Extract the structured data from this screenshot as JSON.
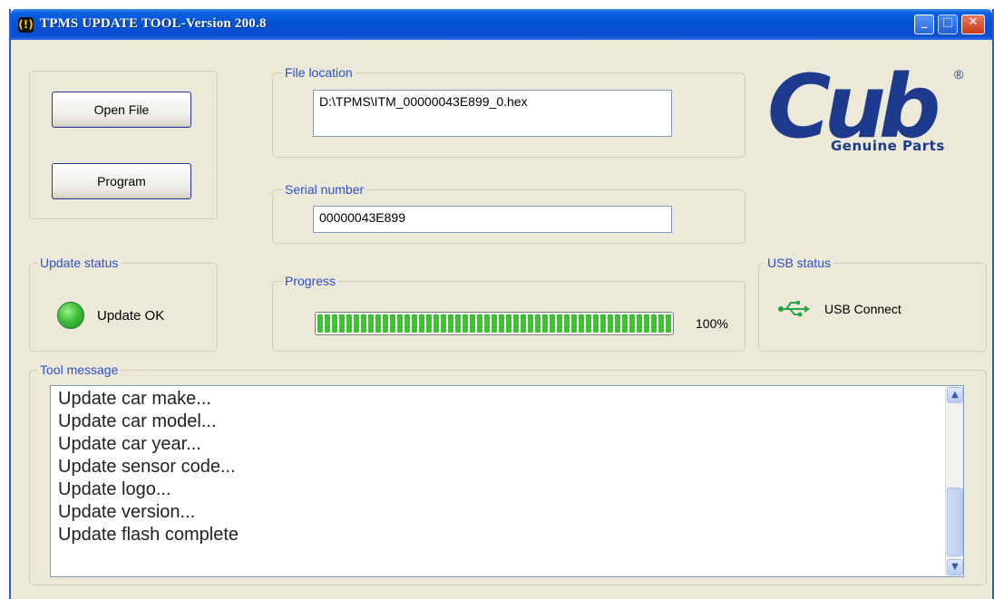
{
  "window": {
    "title": "TPMS UPDATE TOOL-Version 200.8",
    "controls": {
      "minimize": "_",
      "maximize": "□",
      "close": "✕"
    }
  },
  "actions": {
    "open_file_label": "Open File",
    "program_label": "Program"
  },
  "file_location": {
    "legend": "File location",
    "value": "D:\\TPMS\\ITM_00000043E899_0.hex"
  },
  "serial_number": {
    "legend": "Serial number",
    "value": "00000043E899"
  },
  "logo": {
    "brand": "Cub",
    "registered": "®",
    "tagline": "Genuine Parts"
  },
  "update_status": {
    "legend": "Update status",
    "text": "Update OK",
    "indicator_color": "#3fbf3a"
  },
  "progress": {
    "legend": "Progress",
    "value_percent": 100,
    "label": "100%",
    "fill_color": "#3ec234"
  },
  "usb_status": {
    "legend": "USB status",
    "icon": "usb-icon",
    "text": "USB Connect"
  },
  "tool_message": {
    "legend": "Tool message",
    "lines": [
      "Update car make...",
      "Update car model...",
      "Update car year...",
      "Update sensor code...",
      "Update logo...",
      "Update version...",
      "Update flash complete"
    ]
  },
  "colors": {
    "legend_text": "#2b4fd0",
    "window_bg": "#ece9d8",
    "titlebar": "#0553d5",
    "brand": "#1d3a8c"
  }
}
